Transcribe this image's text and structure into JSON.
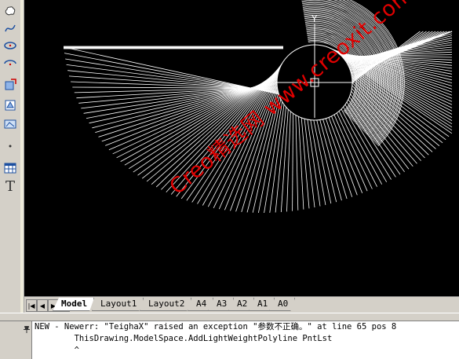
{
  "toolbar": {
    "icons": [
      "revcloud-icon",
      "spline-icon",
      "ellipse-icon",
      "ellipse-arc-icon",
      "insert-block-icon",
      "make-block-icon",
      "point-icon",
      "hatch-icon",
      "table-icon",
      "multiline-text-icon"
    ]
  },
  "drawing": {
    "y_axis_label": "Y",
    "watermark": "Creo精选网 www.creoxit.com",
    "background": "#000000",
    "stroke": "#ffffff"
  },
  "tabs": {
    "nav": [
      "|◀",
      "◀",
      "▶",
      "▶|"
    ],
    "items": [
      {
        "label": "Model",
        "active": true
      },
      {
        "label": "Layout1",
        "active": false
      },
      {
        "label": "Layout2",
        "active": false
      },
      {
        "label": "A4",
        "active": false
      },
      {
        "label": "A3",
        "active": false
      },
      {
        "label": "A2",
        "active": false
      },
      {
        "label": "A1",
        "active": false
      },
      {
        "label": "A0",
        "active": false
      }
    ]
  },
  "command": {
    "lines": [
      "NEW - Newerr: \"TeighaX\" raised an exception \"参数不正确。\" at line 65 pos 8",
      "        ThisDrawing.ModelSpace.AddLightWeightPolyline PntLst",
      "        ^"
    ],
    "side_icon": "pin-icon"
  },
  "colors": {
    "watermark": "#e00000",
    "chrome": "#d4d0c8"
  }
}
